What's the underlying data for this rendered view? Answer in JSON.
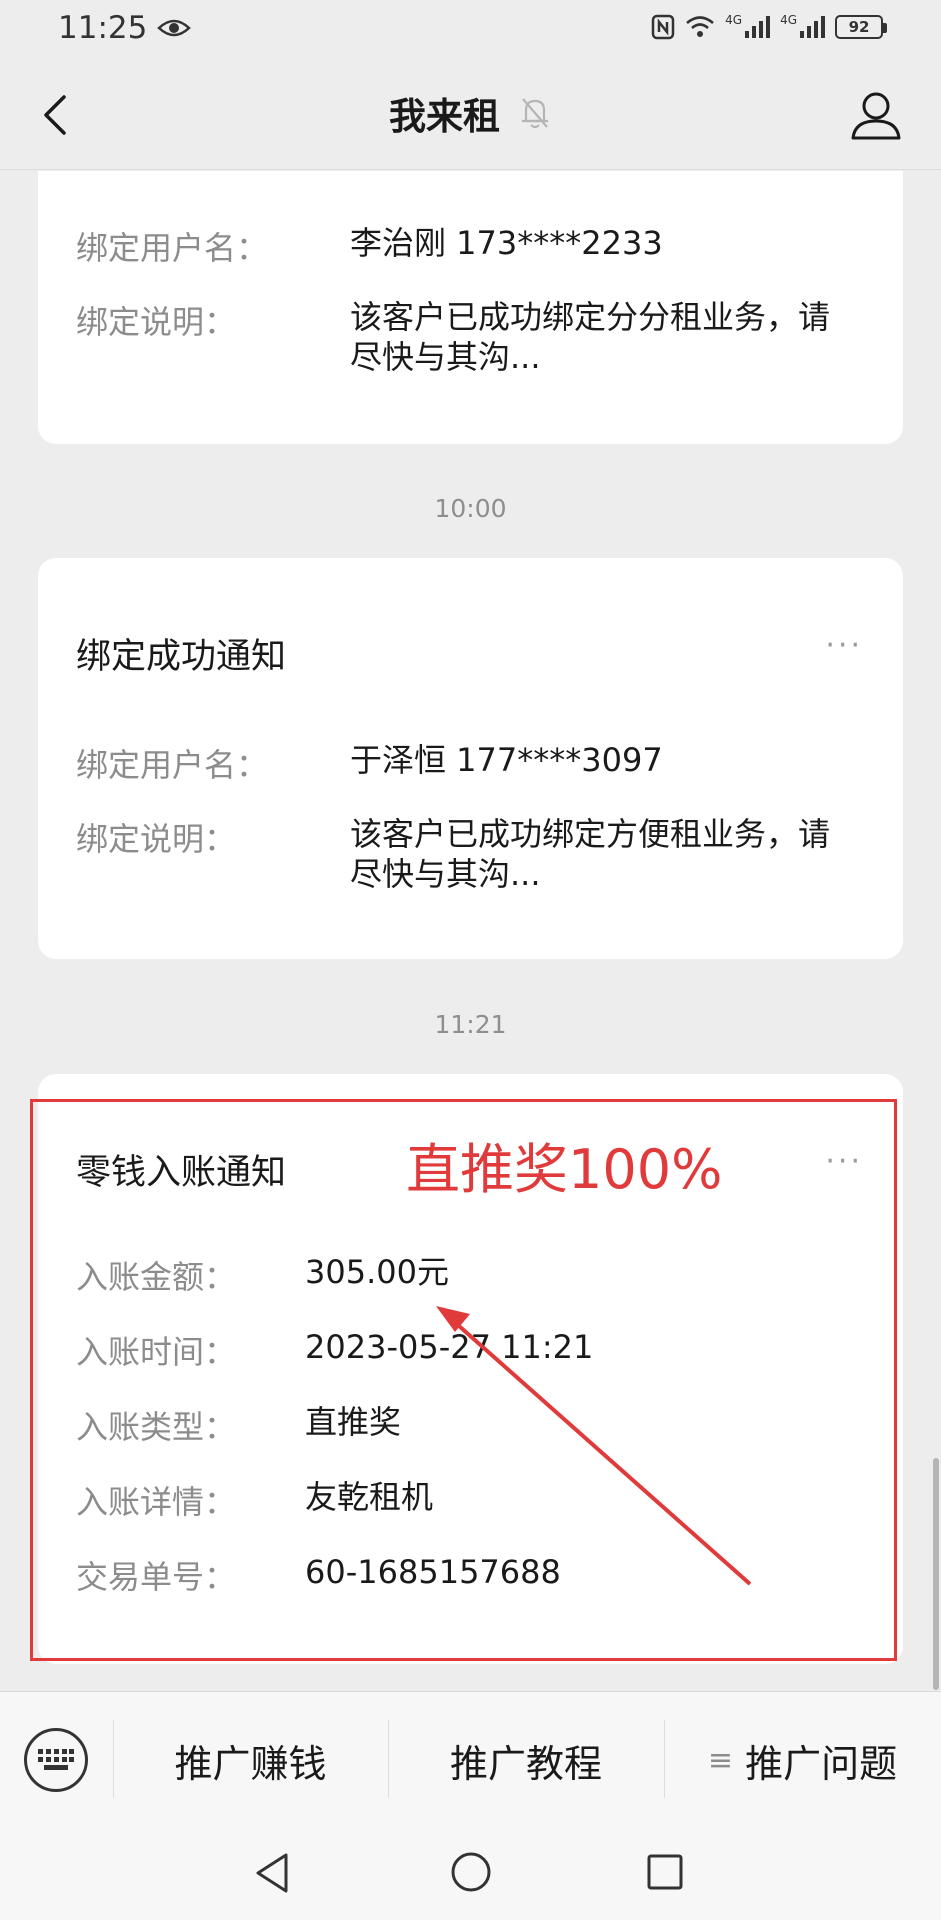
{
  "status_bar": {
    "time": "11:25",
    "network_1": "4G",
    "network_2": "4G",
    "battery": "92"
  },
  "nav": {
    "title": "我来租"
  },
  "cards": [
    {
      "rows": [
        {
          "label": "绑定用户名：",
          "value": "李治刚 173****2233"
        },
        {
          "label": "绑定说明：",
          "value": "该客户已成功绑定分分租业务，请尽快与其沟..."
        }
      ]
    },
    {
      "timestamp": "10:00",
      "title": "绑定成功通知",
      "more": "···",
      "rows": [
        {
          "label": "绑定用户名：",
          "value": "于泽恒 177****3097"
        },
        {
          "label": "绑定说明：",
          "value": "该客户已成功绑定方便租业务，请尽快与其沟..."
        }
      ]
    },
    {
      "timestamp": "11:21",
      "title": "零钱入账通知",
      "more": "···",
      "rows": [
        {
          "label": "入账金额：",
          "value": "305.00元"
        },
        {
          "label": "入账时间：",
          "value": "2023-05-27 11:21"
        },
        {
          "label": "入账类型：",
          "value": "直推奖"
        },
        {
          "label": "入账详情：",
          "value": "友乾租机"
        },
        {
          "label": "交易单号：",
          "value": "60-1685157688"
        }
      ]
    }
  ],
  "annotation": {
    "text": "直推奖100%",
    "color": "#e03a3a"
  },
  "bottom_menu": {
    "items": [
      "推广赚钱",
      "推广教程",
      "推广问题"
    ],
    "third_prefix": "≡"
  }
}
